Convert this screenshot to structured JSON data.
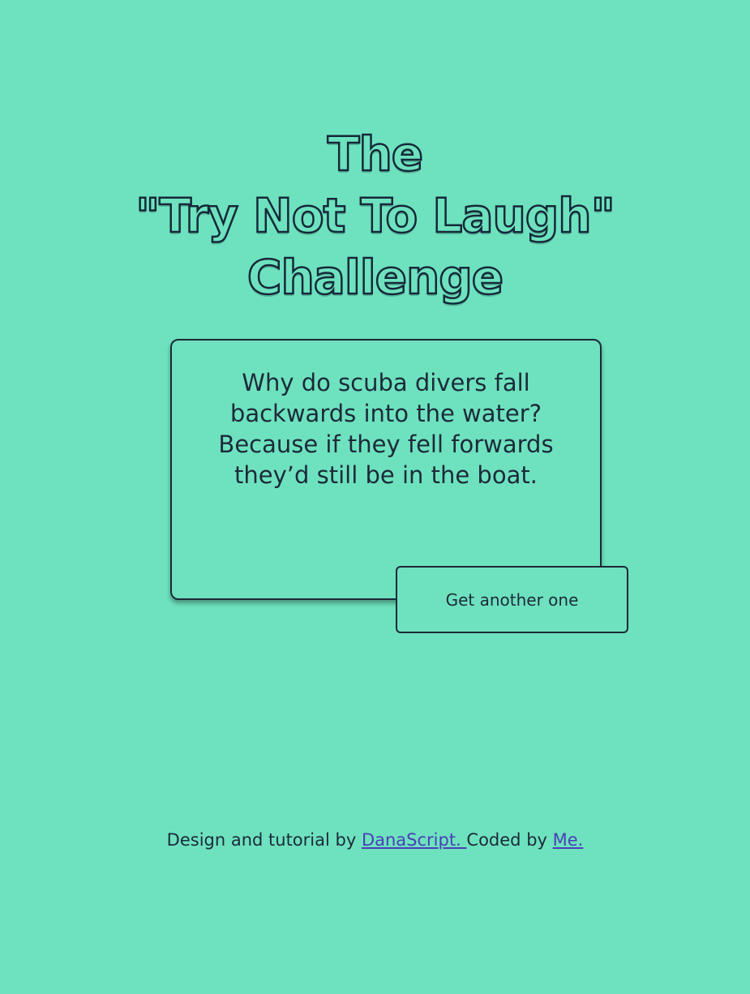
{
  "title": {
    "line1": "The",
    "line2": "\"Try Not To Laugh\"",
    "line3": "Challenge"
  },
  "joke": {
    "text": "Why do scuba divers fall backwards into the water? Because if they fell forwards they’d still be in the boat."
  },
  "button": {
    "label": "Get another one"
  },
  "footer": {
    "prefix": "Design and tutorial by ",
    "link1": "DanaScript. ",
    "middle": "Coded by ",
    "link2": "Me."
  },
  "colors": {
    "background": "#6ee2be",
    "text": "#1c2a3a",
    "link": "#4a3fb8"
  }
}
